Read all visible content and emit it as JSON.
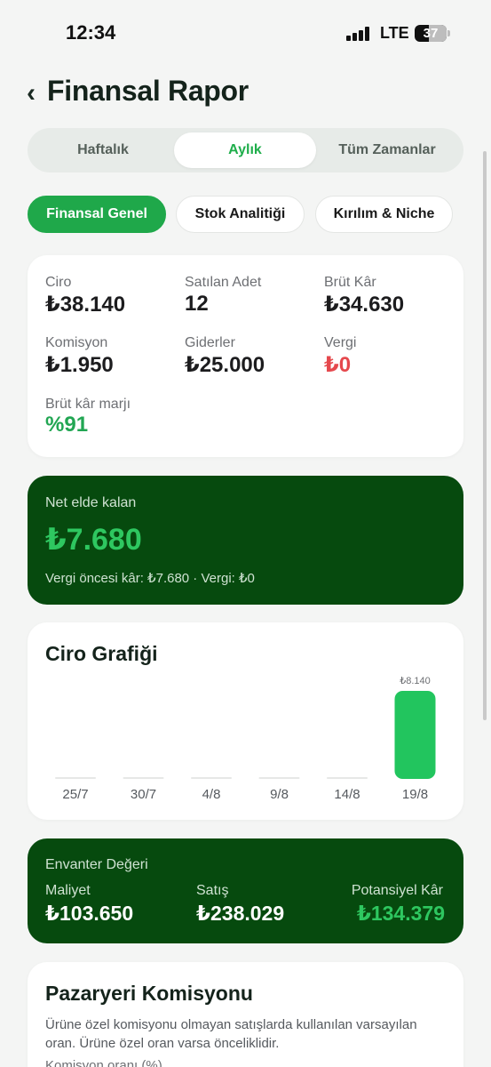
{
  "status": {
    "time": "12:34",
    "network": "LTE",
    "battery": "37"
  },
  "header": {
    "title": "Finansal Rapor"
  },
  "period_tabs": [
    {
      "label": "Haftalık",
      "active": false
    },
    {
      "label": "Aylık",
      "active": true
    },
    {
      "label": "Tüm Zamanlar",
      "active": false
    }
  ],
  "section_tabs": [
    {
      "label": "Finansal Genel",
      "active": true
    },
    {
      "label": "Stok Analitiği",
      "active": false
    },
    {
      "label": "Kırılım & Niche",
      "active": false
    }
  ],
  "summary": {
    "ciro_label": "Ciro",
    "ciro_value": "₺38.140",
    "adet_label": "Satılan Adet",
    "adet_value": "12",
    "brut_label": "Brüt Kâr",
    "brut_value": "₺34.630",
    "komisyon_label": "Komisyon",
    "komisyon_value": "₺1.950",
    "gider_label": "Giderler",
    "gider_value": "₺25.000",
    "vergi_label": "Vergi",
    "vergi_value": "₺0",
    "marj_label": "Brüt kâr marjı",
    "marj_value": "%91"
  },
  "net": {
    "label": "Net elde kalan",
    "value": "₺7.680",
    "sub": "Vergi öncesi kâr: ₺7.680 · Vergi: ₺0"
  },
  "chart_title": "Ciro Grafiği",
  "chart_data": {
    "type": "bar",
    "title": "Ciro Grafiği",
    "categories": [
      "25/7",
      "30/7",
      "4/8",
      "9/8",
      "14/8",
      "19/8"
    ],
    "values": [
      0,
      0,
      0,
      0,
      0,
      8140
    ],
    "data_labels": [
      "",
      "",
      "",
      "",
      "",
      "₺8.140"
    ],
    "ylim": [
      0,
      8140
    ],
    "color": "#22c55e",
    "grid": false
  },
  "inventory": {
    "title": "Envanter Değeri",
    "maliyet_label": "Maliyet",
    "maliyet_value": "₺103.650",
    "satis_label": "Satış",
    "satis_value": "₺238.029",
    "potansiyel_label": "Potansiyel Kâr",
    "potansiyel_value": "₺134.379"
  },
  "komisyon": {
    "title": "Pazaryeri Komisyonu",
    "desc": "Ürüne özel komisyonu olmayan satışlarda kullanılan varsayılan oran. Ürüne özel oran varsa önceliklidir.",
    "field_label": "Komisyon oranı (%)"
  },
  "colors": {
    "accent": "#1fa84a",
    "dark_green": "#064a0e",
    "bright_green": "#2ec760",
    "red": "#e5484d"
  }
}
